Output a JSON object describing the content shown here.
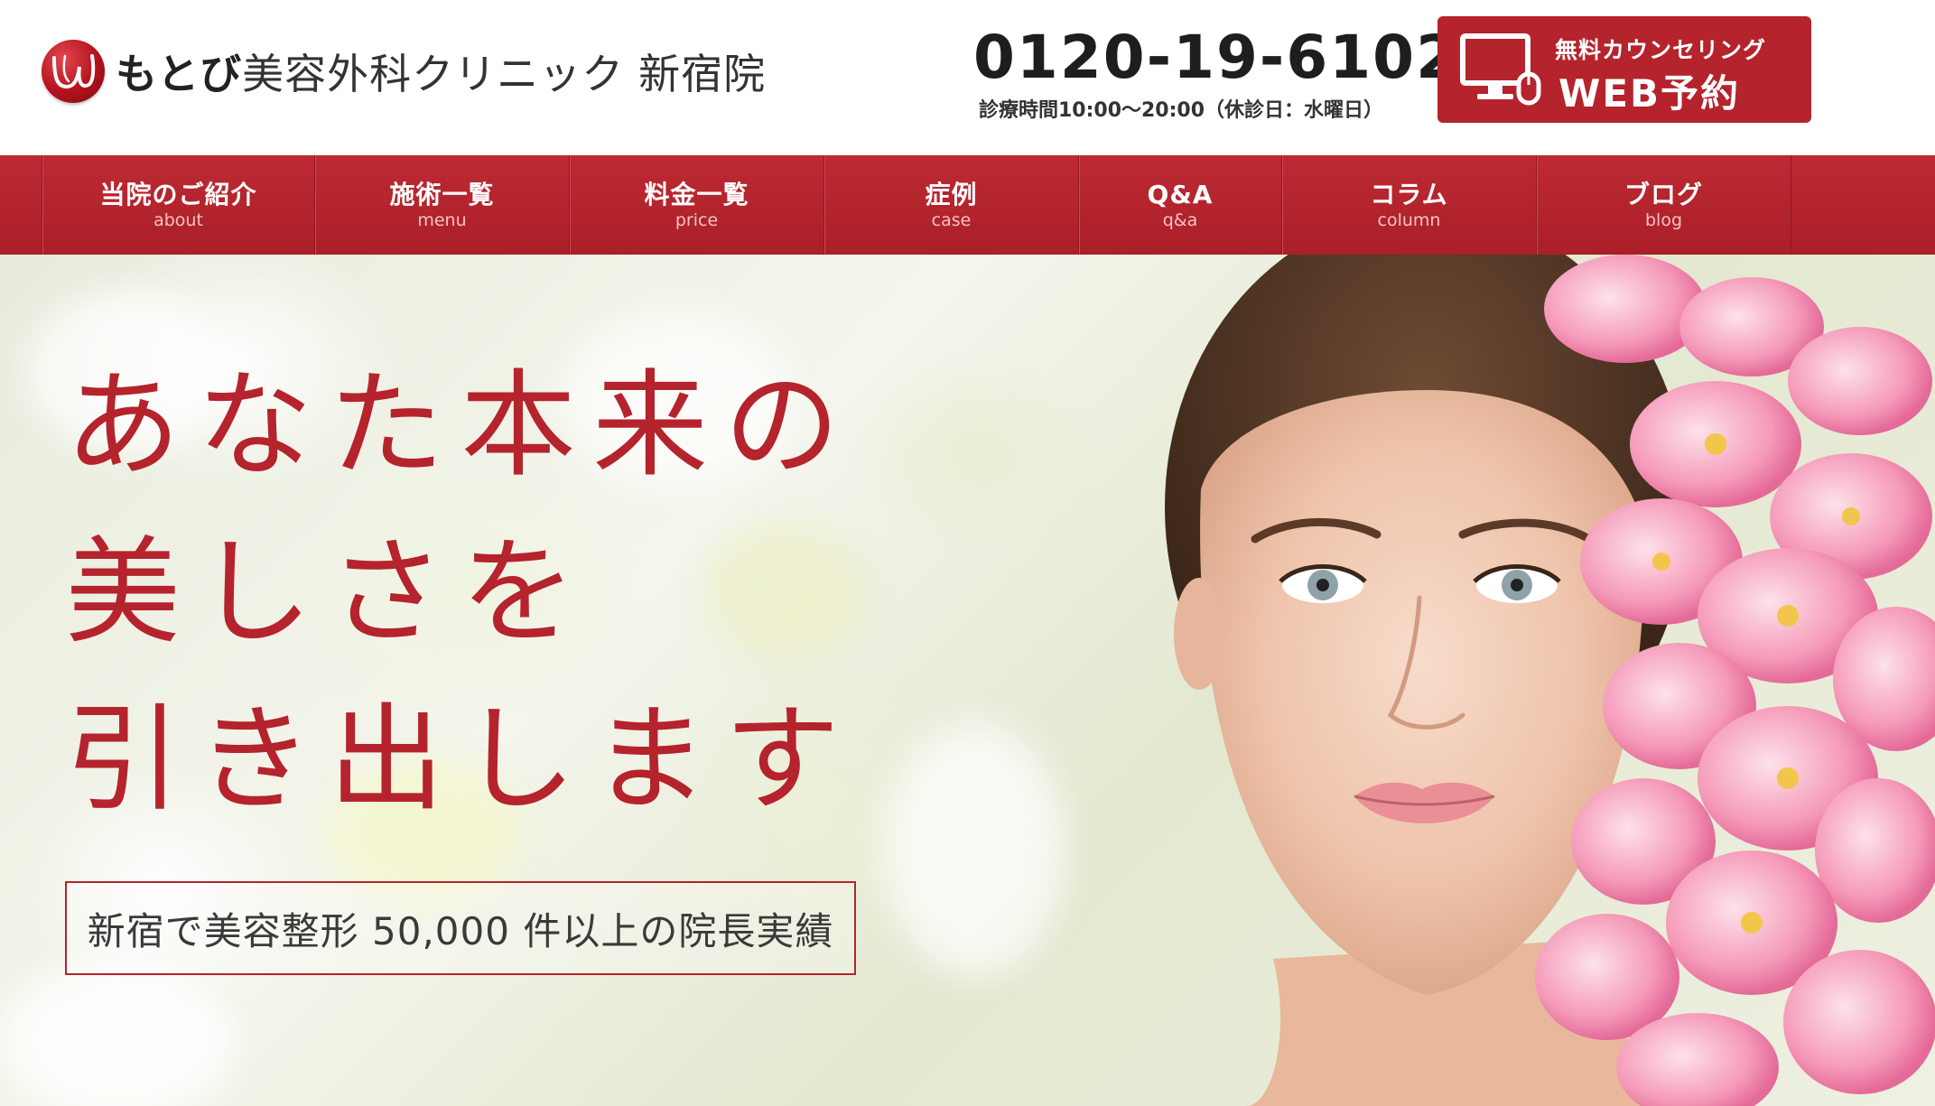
{
  "header": {
    "logo_mark": "U",
    "clinic_name_bold": "もとび",
    "clinic_name_rest": "美容外科クリニック",
    "branch": "新宿院",
    "phone": "0120-19-6102",
    "hours": "診療時間10:00〜20:00（休診日：水曜日）",
    "web_button": {
      "sub_label": "無料カウンセリング",
      "main_label": "WEB予約",
      "icon": "computer-monitor-mouse-icon"
    }
  },
  "nav": {
    "items": [
      {
        "label": "当院のご紹介",
        "sub": "about"
      },
      {
        "label": "施術一覧",
        "sub": "menu"
      },
      {
        "label": "料金一覧",
        "sub": "price"
      },
      {
        "label": "症例",
        "sub": "case"
      },
      {
        "label": "Q&A",
        "sub": "q&a"
      },
      {
        "label": "コラム",
        "sub": "column"
      },
      {
        "label": "ブログ",
        "sub": "blog"
      }
    ]
  },
  "hero": {
    "headline_lines": [
      "あなた本来の",
      "美しさを",
      "引き出します"
    ],
    "tagline": "新宿で美容整形 50,000 件以上の院長実績"
  },
  "colors": {
    "brand_red": "#b5232c",
    "nav_red": "#b3252e",
    "text_dark": "#222222"
  }
}
